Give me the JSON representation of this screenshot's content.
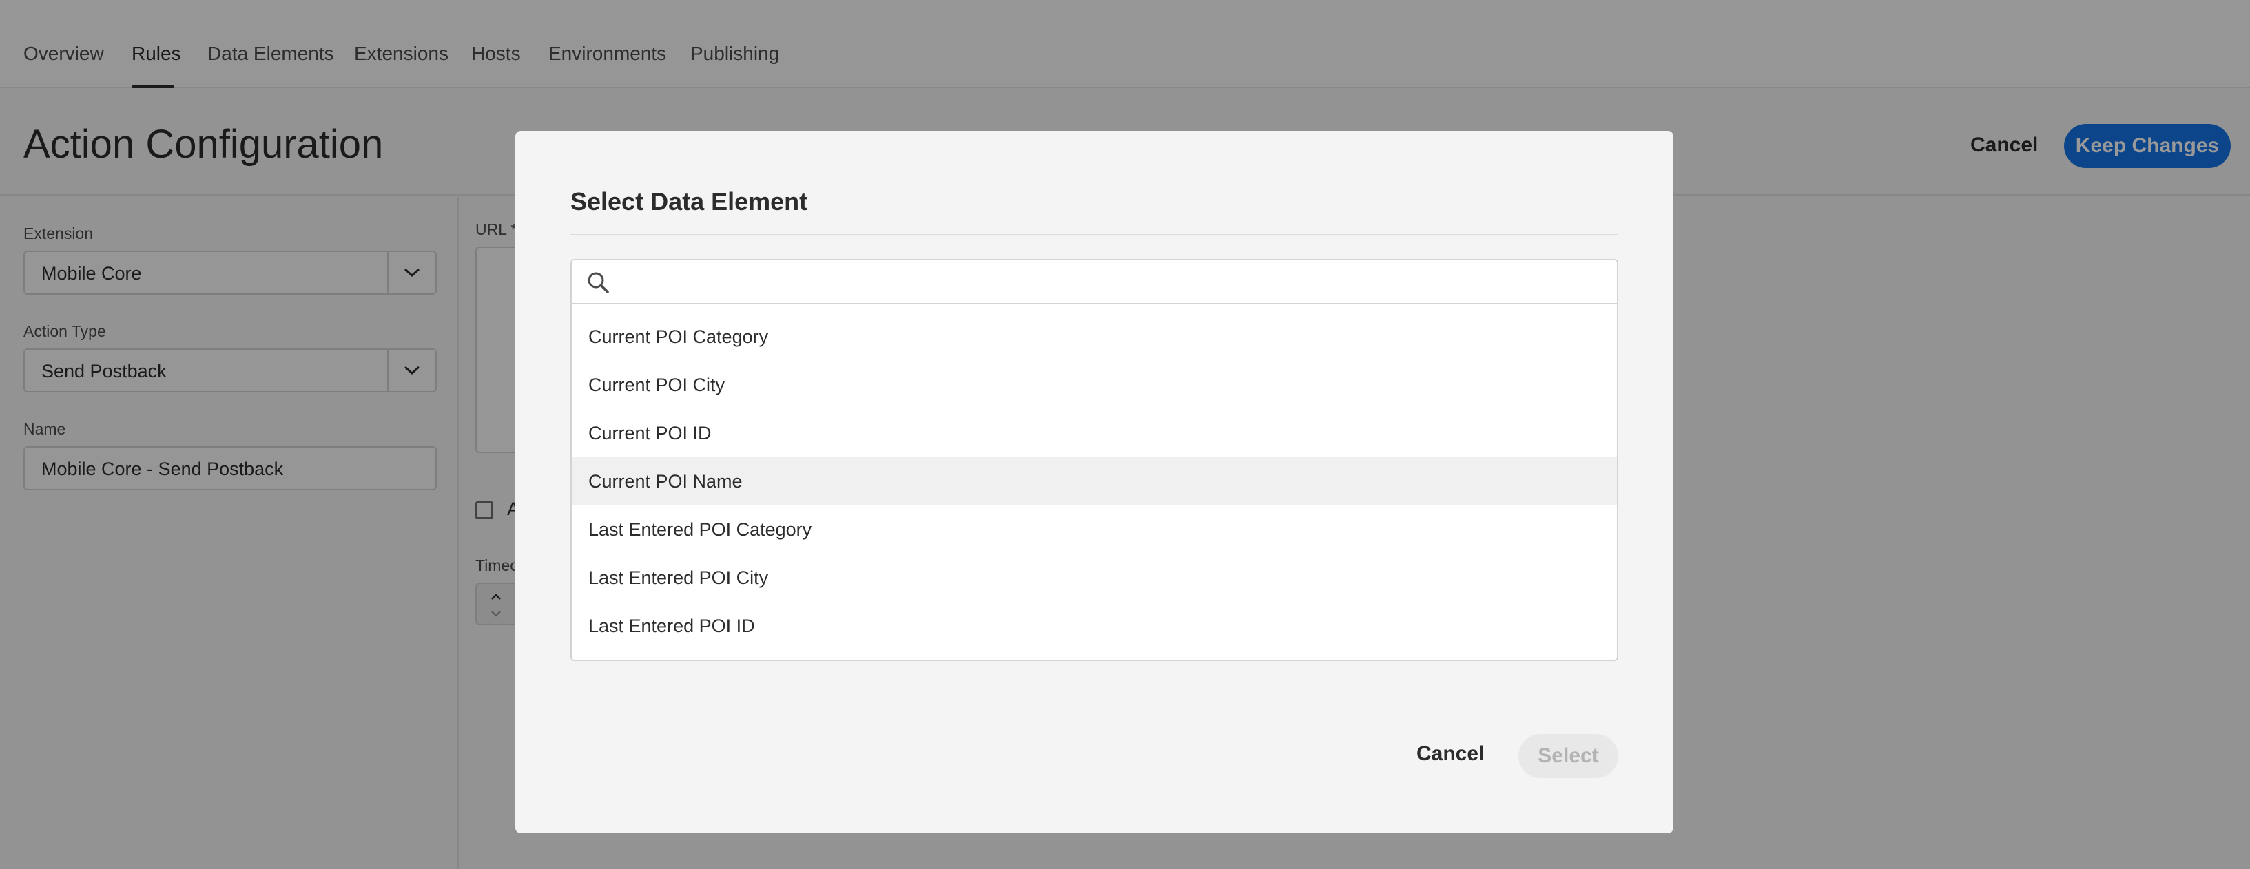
{
  "nav": {
    "tabs": [
      {
        "label": "Overview"
      },
      {
        "label": "Rules"
      },
      {
        "label": "Data Elements"
      },
      {
        "label": "Extensions"
      },
      {
        "label": "Hosts"
      },
      {
        "label": "Environments"
      },
      {
        "label": "Publishing"
      }
    ],
    "active": "Rules"
  },
  "header": {
    "title": "Action Configuration",
    "cancel_label": "Cancel",
    "keep_label": "Keep Changes"
  },
  "form": {
    "extension_label": "Extension",
    "extension_value": "Mobile Core",
    "action_type_label": "Action Type",
    "action_type_value": "Send Postback",
    "name_label": "Name",
    "name_value": "Mobile Core - Send Postback",
    "url_label": "URL *",
    "checkbox_label": "A",
    "timeout_label": "Timeo"
  },
  "dialog": {
    "title": "Select Data Element",
    "search_placeholder": "",
    "items": [
      {
        "label": "Current POI Category"
      },
      {
        "label": "Current POI City"
      },
      {
        "label": "Current POI ID"
      },
      {
        "label": "Current POI Name"
      },
      {
        "label": "Last Entered POI Category"
      },
      {
        "label": "Last Entered POI City"
      },
      {
        "label": "Last Entered POI ID"
      }
    ],
    "highlighted": "Current POI Name",
    "cancel_label": "Cancel",
    "select_label": "Select"
  },
  "colors": {
    "accent": "#1473e6",
    "overlay": "rgba(0,0,0,0.4)"
  }
}
